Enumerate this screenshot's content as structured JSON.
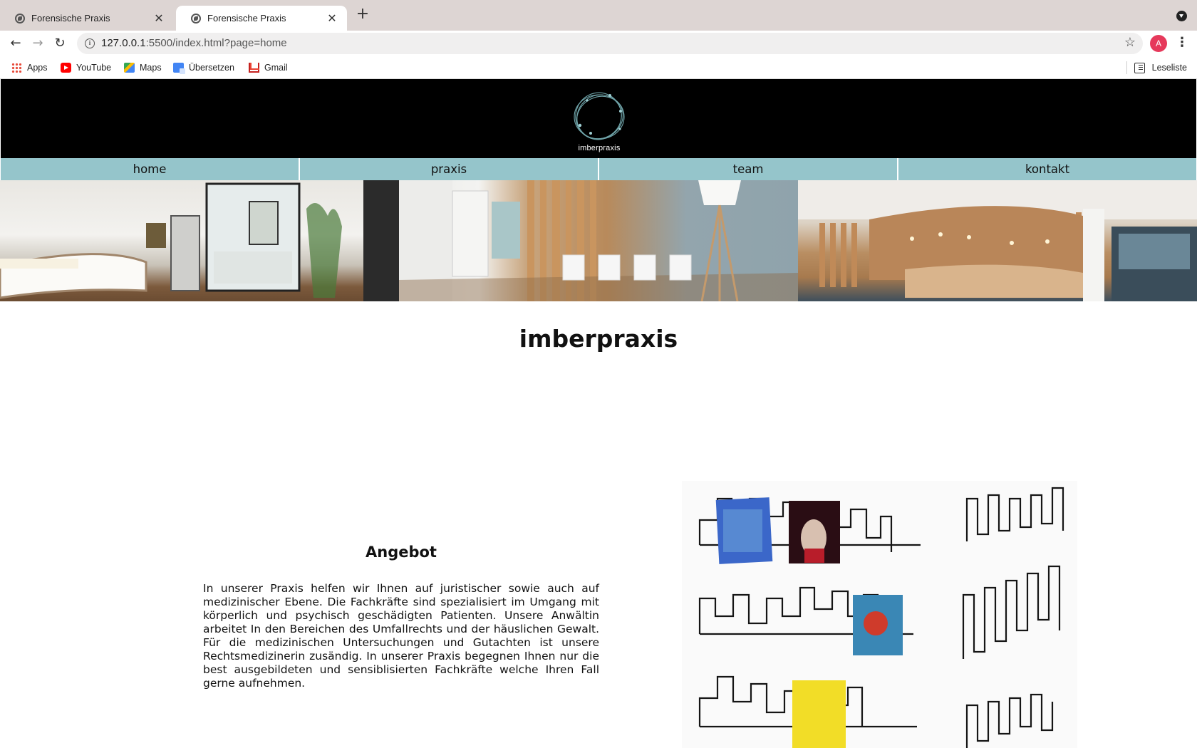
{
  "browser": {
    "tabs": [
      {
        "title": "Forensische Praxis",
        "active": false
      },
      {
        "title": "Forensische Praxis",
        "active": true
      }
    ],
    "url_host": "127.0.0.1",
    "url_path": ":5500/index.html?page=home",
    "profile_initial": "A",
    "bookmarks": [
      {
        "label": "Apps",
        "icon": "apps-grid-icon"
      },
      {
        "label": "YouTube",
        "icon": "youtube-icon"
      },
      {
        "label": "Maps",
        "icon": "maps-icon"
      },
      {
        "label": "Übersetzen",
        "icon": "translate-icon"
      },
      {
        "label": "Gmail",
        "icon": "gmail-icon"
      }
    ],
    "reading_list": "Leseliste"
  },
  "site": {
    "brand": "imberpraxis",
    "colors": {
      "header_bg": "#000000",
      "nav_bg": "#95c5cb",
      "logo_ring": "#6fa3a8"
    },
    "nav": [
      "home",
      "praxis",
      "team",
      "kontakt"
    ],
    "headline": "imberpraxis",
    "section": {
      "title": "Angebot",
      "text": "In unserer Praxis helfen wir Ihnen auf juristischer sowie auch auf medizinischer Ebene. Die Fachkräfte sind spezialisiert im Umgang mit körperlich und psychisch geschädigten Patienten. Unsere Anwältin arbeitet In den Bereichen des Umfallrechts und der häuslichen Gewalt. Für die medizinischen Untersuchungen und Gutachten ist unsere Rechtsmedizinerin zusändig. In unserer Praxis begegnen Ihnen nur die best ausgebildeten und sensiblisierten Fachkräfte welche Ihren Fall gerne aufnehmen."
    }
  }
}
